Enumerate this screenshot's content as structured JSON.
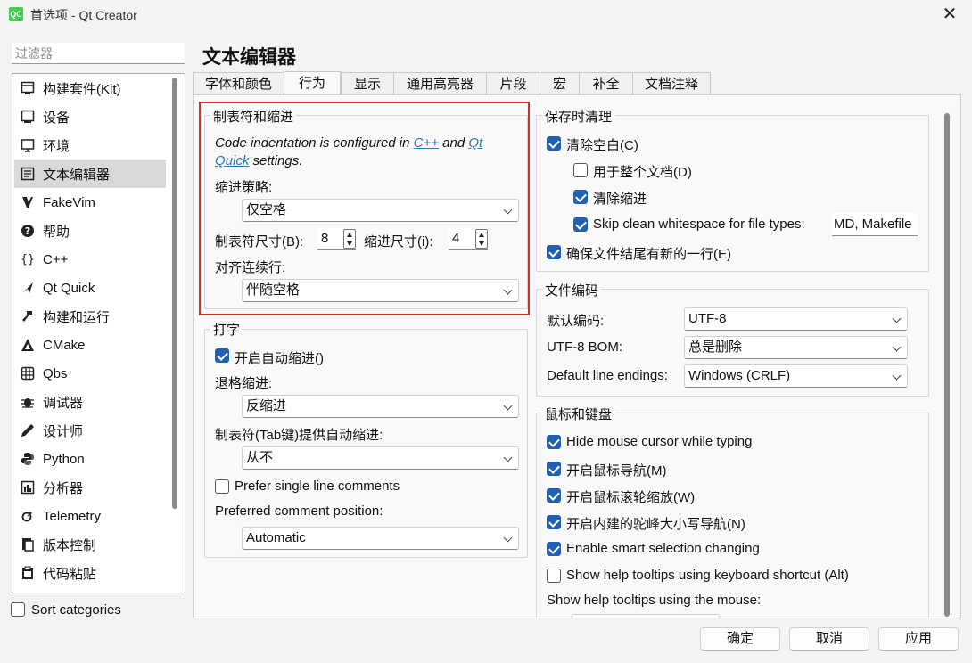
{
  "window": {
    "title": "首选项 - Qt Creator",
    "app_icon": "QC"
  },
  "sidebar": {
    "filter_placeholder": "过滤器",
    "items": [
      {
        "label": "构建套件(Kit)",
        "icon": "monitor-icon"
      },
      {
        "label": "设备",
        "icon": "device-icon"
      },
      {
        "label": "环境",
        "icon": "screen-icon"
      },
      {
        "label": "文本编辑器",
        "icon": "text-editor-icon",
        "selected": true
      },
      {
        "label": "FakeVim",
        "icon": "fakevim-icon"
      },
      {
        "label": "帮助",
        "icon": "help-icon"
      },
      {
        "label": "C++",
        "icon": "braces-icon"
      },
      {
        "label": "Qt Quick",
        "icon": "qtquick-icon"
      },
      {
        "label": "构建和运行",
        "icon": "hammer-icon"
      },
      {
        "label": "CMake",
        "icon": "cmake-icon"
      },
      {
        "label": "Qbs",
        "icon": "qbs-icon"
      },
      {
        "label": "调试器",
        "icon": "bug-icon"
      },
      {
        "label": "设计师",
        "icon": "pen-icon"
      },
      {
        "label": "Python",
        "icon": "python-icon"
      },
      {
        "label": "分析器",
        "icon": "analyzer-icon"
      },
      {
        "label": "Telemetry",
        "icon": "telemetry-icon"
      },
      {
        "label": "版本控制",
        "icon": "vcs-icon"
      },
      {
        "label": "代码粘贴",
        "icon": "paste-icon"
      }
    ],
    "sort_categories": {
      "label": "Sort categories",
      "checked": false
    }
  },
  "page": {
    "title": "文本编辑器",
    "tabs": [
      {
        "label": "字体和颜色"
      },
      {
        "label": "行为",
        "active": true
      },
      {
        "label": "显示"
      },
      {
        "label": "通用高亮器"
      },
      {
        "label": "片段"
      },
      {
        "label": "宏"
      },
      {
        "label": "补全"
      },
      {
        "label": "文档注释"
      }
    ]
  },
  "tabs_indent": {
    "title": "制表符和缩进",
    "info_pre": "Code indentation is configured in ",
    "info_link1": "C++",
    "info_mid": " and ",
    "info_link2a": "Qt",
    "info_link2b": "Quick",
    "info_post": " settings.",
    "policy_label": "缩进策略:",
    "policy_value": "仅空格",
    "tab_size_label": "制表符尺寸(B):",
    "tab_size_value": "8",
    "indent_size_label": "缩进尺寸(i):",
    "indent_size_value": "4",
    "align_label": "对齐连续行:",
    "align_value": "伴随空格"
  },
  "typing": {
    "title": "打字",
    "auto_indent": {
      "label": "开启自动缩进()",
      "checked": true
    },
    "backspace_label": "退格缩进:",
    "backspace_value": "反缩进",
    "tab_key_label": "制表符(Tab键)提供自动缩进:",
    "tab_key_value": "从不",
    "single_line": {
      "label": "Prefer single line comments",
      "checked": false
    },
    "comment_pos_label": "Preferred comment position:",
    "comment_pos_value": "Automatic"
  },
  "cleanup": {
    "title": "保存时清理",
    "clean_ws": {
      "label": "清除空白(C)",
      "checked": true
    },
    "entire_doc": {
      "label": "用于整个文档(D)",
      "checked": false
    },
    "clean_indent": {
      "label": "清除缩进",
      "checked": true
    },
    "skip_clean": {
      "label": "Skip clean whitespace for file types:",
      "checked": true
    },
    "skip_types_value": "MD, Makefile",
    "ensure_newline": {
      "label": "确保文件结尾有新的一行(E)",
      "checked": true
    }
  },
  "encoding": {
    "title": "文件编码",
    "default_label": "默认编码:",
    "default_value": "UTF-8",
    "bom_label": "UTF-8 BOM:",
    "bom_value": "总是删除",
    "line_end_label": "Default line endings:",
    "line_end_value": "Windows (CRLF)"
  },
  "mouse": {
    "title": "鼠标和键盘",
    "hide_cursor": {
      "label": "Hide mouse cursor while typing",
      "checked": true
    },
    "mouse_nav": {
      "label": "开启鼠标导航(M)",
      "checked": true
    },
    "wheel_zoom": {
      "label": "开启鼠标滚轮缩放(W)",
      "checked": true
    },
    "camel_nav": {
      "label": "开启内建的驼峰大小写导航(N)",
      "checked": true
    },
    "smart_sel": {
      "label": "Enable smart selection changing",
      "checked": true
    },
    "help_kbd": {
      "label": "Show help tooltips using keyboard shortcut (Alt)",
      "checked": false
    },
    "help_mouse_label": "Show help tooltips using the mouse:"
  },
  "buttons": {
    "ok": "确定",
    "cancel": "取消",
    "apply": "应用"
  }
}
